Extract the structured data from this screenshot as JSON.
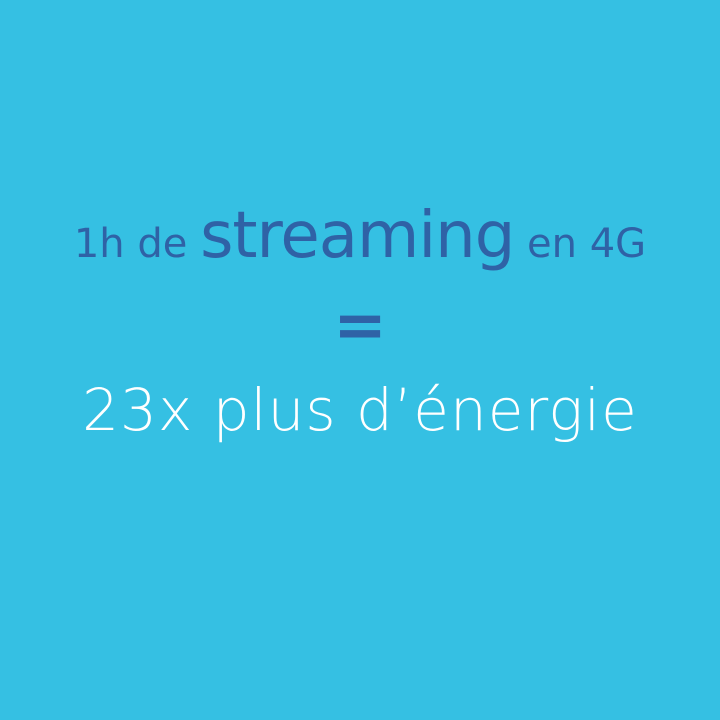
{
  "headline": {
    "prefix": "1h de ",
    "emphasis": "streaming",
    "suffix": " en 4G"
  },
  "equals": "=",
  "result": "23x plus d’énergie",
  "colors": {
    "background": "#35c0e3",
    "headline": "#2f62a6",
    "result": "#ffffff"
  }
}
